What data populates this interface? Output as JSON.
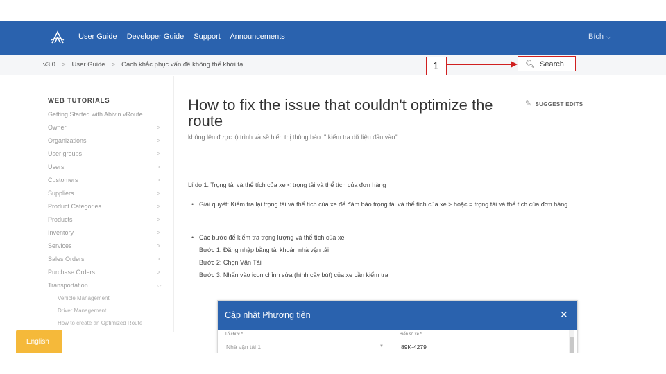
{
  "nav": {
    "items": [
      "User Guide",
      "Developer Guide",
      "Support",
      "Announcements"
    ],
    "user": "Bích"
  },
  "breadcrumb": [
    "v3.0",
    "User Guide",
    "Cách khắc phục vấn đề không thể khởi tạ..."
  ],
  "search": {
    "label": "Search"
  },
  "annotation": {
    "number": "1"
  },
  "sidebar": {
    "heading": "WEB TUTORIALS",
    "items": [
      "Getting Started with Abivin vRoute ...",
      "Owner",
      "Organizations",
      "User groups",
      "Users",
      "Customers",
      "Suppliers",
      "Product Categories",
      "Products",
      "Inventory",
      "Services",
      "Sales Orders",
      "Purchase Orders",
      "Transportation"
    ],
    "subitems": [
      "Vehicle Management",
      "Driver Management",
      "How to create an Optimized Route"
    ]
  },
  "article": {
    "title": "How to fix the issue that couldn't optimize the route",
    "suggest_edits": "SUGGEST EDITS",
    "subtitle": "không lên được lộ trình và sẽ hiển thị thông báo: \" kiểm tra dữ liệu đầu vào\"",
    "reason": "Lí do 1: Trọng tải và thể tích của xe < trọng tải và thể tích của đơn hàng",
    "solution": "Giải quyết: Kiểm tra lại trọng tải và thể tích của xe để đảm bảo trọng tải và thể tích của xe > hoặc = trọng tải và thể tích của đơn hàng",
    "steps_title": "Các bước để kiểm tra trọng lượng và thể tích của xe",
    "step1": "Bước 1: Đăng nhập bằng tài khoản nhà vận tải",
    "step2": "Bước 2: Chọn Vận Tải",
    "step3": "Bước 3: Nhấn vào icon chỉnh sửa (hình cây bút) của xe cần kiểm tra"
  },
  "dialog": {
    "title": "Cập nhật Phương tiện",
    "field1_label": "Tổ chức *",
    "field1_value": "Nhà vận tải 1",
    "field2_label": "Biển số xe *",
    "field2_value": "89K-4279"
  },
  "language": "English",
  "icons": {
    "logo": "abivin-logo-icon",
    "search": "search-icon",
    "chevron": "chevron-down-icon",
    "close": "close-icon",
    "edit": "edit-icon"
  },
  "colors": {
    "nav_bg": "#2a62ae",
    "annotation": "#d02020",
    "language_btn": "#f5b93a"
  }
}
